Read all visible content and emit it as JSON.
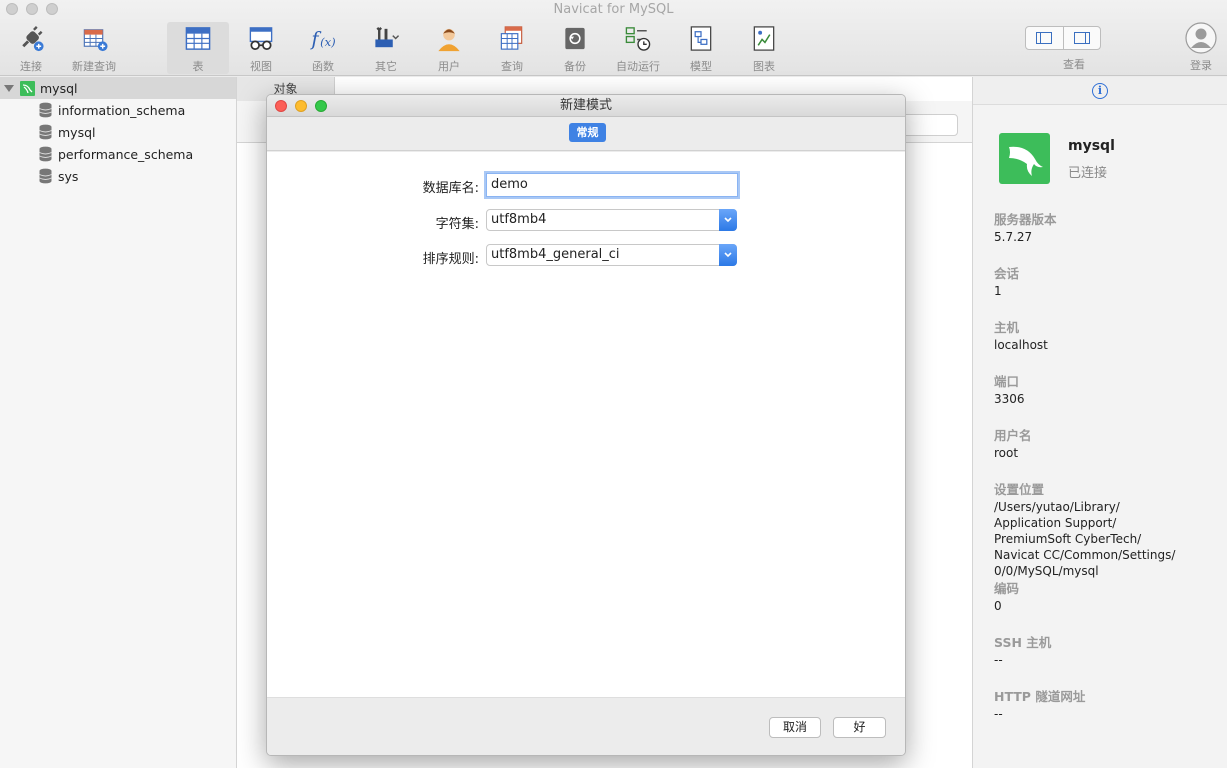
{
  "window": {
    "title": "Navicat for MySQL"
  },
  "toolbar": {
    "connect": "连接",
    "new_query": "新建查询",
    "table": "表",
    "view": "视图",
    "function": "函数",
    "other": "其它",
    "user": "用户",
    "query": "查询",
    "backup": "备份",
    "automation": "自动运行",
    "model": "模型",
    "chart": "图表",
    "view_toggle": "查看",
    "login": "登录"
  },
  "sidebar": {
    "connection": "mysql",
    "databases": [
      "information_schema",
      "mysql",
      "performance_schema",
      "sys"
    ]
  },
  "center": {
    "tab": "对象"
  },
  "dialog": {
    "title": "新建模式",
    "tab_general": "常规",
    "db_name_label": "数据库名:",
    "db_name_value": "demo",
    "charset_label": "字符集:",
    "charset_value": "utf8mb4",
    "collation_label": "排序规则:",
    "collation_value": "utf8mb4_general_ci",
    "cancel": "取消",
    "ok": "好"
  },
  "info_panel": {
    "name": "mysql",
    "status": "已连接",
    "props": [
      {
        "key": "服务器版本",
        "value": "5.7.27"
      },
      {
        "key": "会话",
        "value": "1"
      },
      {
        "key": "主机",
        "value": "localhost"
      },
      {
        "key": "端口",
        "value": "3306"
      },
      {
        "key": "用户名",
        "value": "root"
      },
      {
        "key": "设置位置",
        "value": "/Users/yutao/Library/\nApplication Support/\nPremiumSoft CyberTech/\nNavicat CC/Common/Settings/\n0/0/MySQL/mysql"
      },
      {
        "key": "编码",
        "value": "0"
      },
      {
        "key": "SSH 主机",
        "value": "--"
      },
      {
        "key": "HTTP 隧道网址",
        "value": "--"
      }
    ]
  },
  "colors": {
    "accent": "#3f82e4",
    "logo_green": "#3dbd5a"
  }
}
